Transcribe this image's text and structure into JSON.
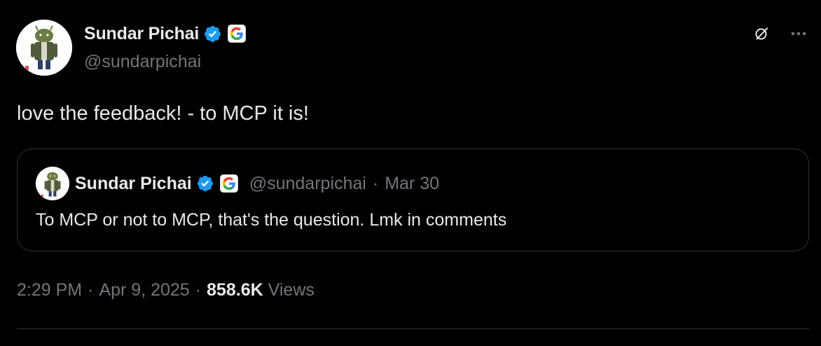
{
  "author": {
    "display_name": "Sundar Pichai",
    "handle": "@sundarpichai",
    "verified_icon": "verified-badge-icon",
    "affiliation_icon": "google-logo-icon"
  },
  "tweet": {
    "text": "love the feedback! - to MCP it is!",
    "time": "2:29 PM",
    "separator": "·",
    "date": "Apr 9, 2025",
    "views_count": "858.6K",
    "views_label": "Views"
  },
  "quoted_tweet": {
    "display_name": "Sundar Pichai",
    "handle": "@sundarpichai",
    "separator": "·",
    "date": "Mar 30",
    "text": "To MCP or not to MCP, that's the question. Lmk in comments"
  },
  "actions": {
    "grok_icon": "grok-icon",
    "more_icon": "more-options-icon"
  },
  "colors": {
    "background": "#000000",
    "primary_text": "#e7e9ea",
    "secondary_text": "#71767b",
    "verified_blue": "#1d9bf0",
    "border": "#2f3336"
  }
}
